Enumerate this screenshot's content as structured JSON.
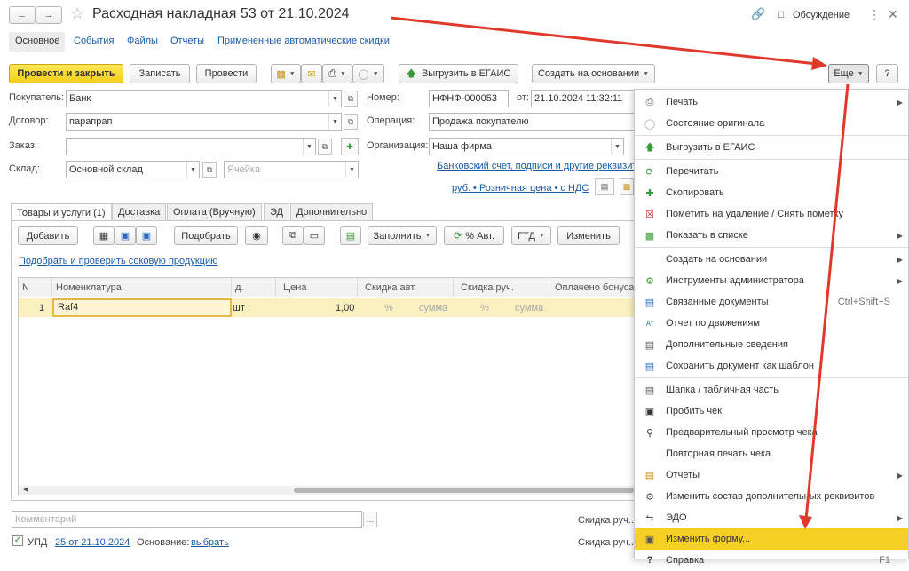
{
  "window": {
    "title": "Расходная накладная 53 от 21.10.2024",
    "discussion": "Обсуждение"
  },
  "nav_tabs": [
    "Основное",
    "События",
    "Файлы",
    "Отчеты",
    "Примененные автоматические скидки"
  ],
  "toolbar": {
    "post_close": "Провести и закрыть",
    "save": "Записать",
    "post": "Провести",
    "upload_egais": "Выгрузить в ЕГАИС",
    "create_based": "Создать на основании",
    "more": "Еще",
    "help": "?"
  },
  "form": {
    "buyer_label": "Покупатель:",
    "buyer": "Банк",
    "contract_label": "Договор:",
    "contract": "парапрап",
    "order_label": "Заказ:",
    "order": "",
    "warehouse_label": "Склад:",
    "warehouse": "Основной склад",
    "cell_placeholder": "Ячейка",
    "number_label": "Номер:",
    "number": "НФНФ-000053",
    "from_label": "от:",
    "date": "21.10.2024 11:32:11",
    "operation_label": "Операция:",
    "operation": "Продажа покупателю",
    "org_label": "Организация:",
    "org": "Наша фирма",
    "bank_link": "Банковский счет, подписи и другие реквизиты",
    "price_link": "руб. • Розничная цена • с НДС"
  },
  "doc_tabs": [
    "Товары и услуги (1)",
    "Доставка",
    "Оплата (Вручную)",
    "ЭД",
    "Дополнительно"
  ],
  "table_toolbar": {
    "add": "Добавить",
    "pick": "Подобрать",
    "fill": "Заполнить",
    "auto_pct": "% Авт.",
    "gtd": "ГТД",
    "change": "Изменить"
  },
  "check_link": "Подобрать и проверить соковую продукцию",
  "table": {
    "headers": [
      "N",
      "Номенклатура",
      "д.",
      "Цена",
      "Скидка авт.",
      "Скидка руч.",
      "Оплачено бонуса"
    ],
    "rows": [
      {
        "n": "1",
        "item": "Raf4",
        "unit": "шт",
        "price": "1,00",
        "auto_pct": "%",
        "auto_sum": "сумма",
        "man_pct": "%",
        "man_sum": "сумма"
      }
    ]
  },
  "footer": {
    "comment_placeholder": "Комментарий",
    "upd_label": "УПД",
    "upd_link": "25 от 21.10.2024",
    "basis_label": "Основание:",
    "basis_link": "выбрать",
    "discount1": "Скидка руч...",
    "discount2": "Скидка руч..."
  },
  "menu": {
    "items": [
      {
        "label": "Печать",
        "icon": "printer-icon",
        "submenu": true
      },
      {
        "label": "Состояние оригинала",
        "icon": "circle-icon"
      },
      {
        "label": "Выгрузить в ЕГАИС",
        "icon": "upload-arrow-icon"
      },
      {
        "label": "Перечитать",
        "icon": "refresh-icon"
      },
      {
        "label": "Скопировать",
        "icon": "copy-icon"
      },
      {
        "label": "Пометить на удаление / Снять пометку",
        "icon": "delete-mark-icon"
      },
      {
        "label": "Показать в списке",
        "icon": "list-icon",
        "submenu": true
      },
      {
        "label": "Создать на основании",
        "submenu": true
      },
      {
        "label": "Инструменты администратора",
        "icon": "tools-icon",
        "submenu": true
      },
      {
        "label": "Связанные документы",
        "icon": "linked-docs-icon",
        "shortcut": "Ctrl+Shift+S"
      },
      {
        "label": "Отчет по движениям",
        "icon": "movements-icon"
      },
      {
        "label": "Дополнительные сведения",
        "icon": "info-icon"
      },
      {
        "label": "Сохранить документ как шаблон",
        "icon": "template-icon"
      },
      {
        "label": "Шапка / табличная часть",
        "icon": "layout-icon"
      },
      {
        "label": "Пробить чек",
        "icon": "receipt-icon"
      },
      {
        "label": "Предварительный просмотр чека",
        "icon": "preview-icon"
      },
      {
        "label": "Повторная печать чека"
      },
      {
        "label": "Отчеты",
        "icon": "reports-icon",
        "submenu": true
      },
      {
        "label": "Изменить состав дополнительных реквизитов",
        "icon": "attributes-icon"
      },
      {
        "label": "ЭДО",
        "icon": "edo-icon",
        "submenu": true
      },
      {
        "label": "Изменить форму...",
        "icon": "form-icon"
      },
      {
        "label": "Справка",
        "icon": "help-icon",
        "shortcut": "F1"
      }
    ]
  }
}
